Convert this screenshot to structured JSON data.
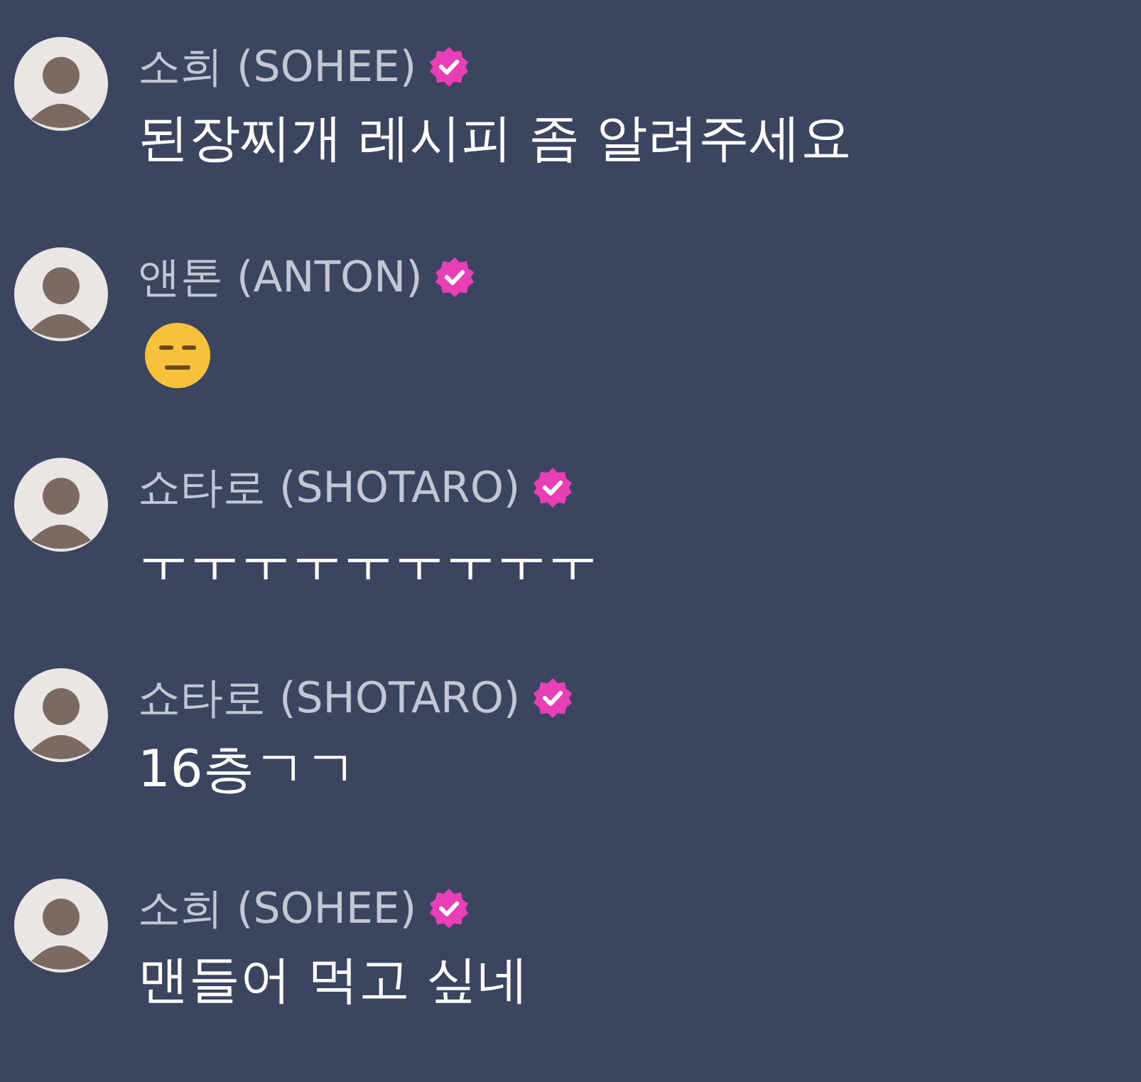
{
  "messages": [
    {
      "name": "소희 (SOHEE)",
      "verified": true,
      "kind": "text",
      "text": "된장찌개 레시피 좀 알려주세요"
    },
    {
      "name": "앤톤 (ANTON)",
      "verified": true,
      "kind": "emoji"
    },
    {
      "name": "쇼타로 (SHOTARO)",
      "verified": true,
      "kind": "text",
      "text": "ㅜㅜㅜㅜㅜㅜㅜㅜㅜ"
    },
    {
      "name": "쇼타로 (SHOTARO)",
      "verified": true,
      "kind": "text",
      "text": "16층ㄱㄱ"
    },
    {
      "name": "소희 (SOHEE)",
      "verified": true,
      "kind": "text",
      "text": "맨들어 먹고 싶네"
    }
  ]
}
